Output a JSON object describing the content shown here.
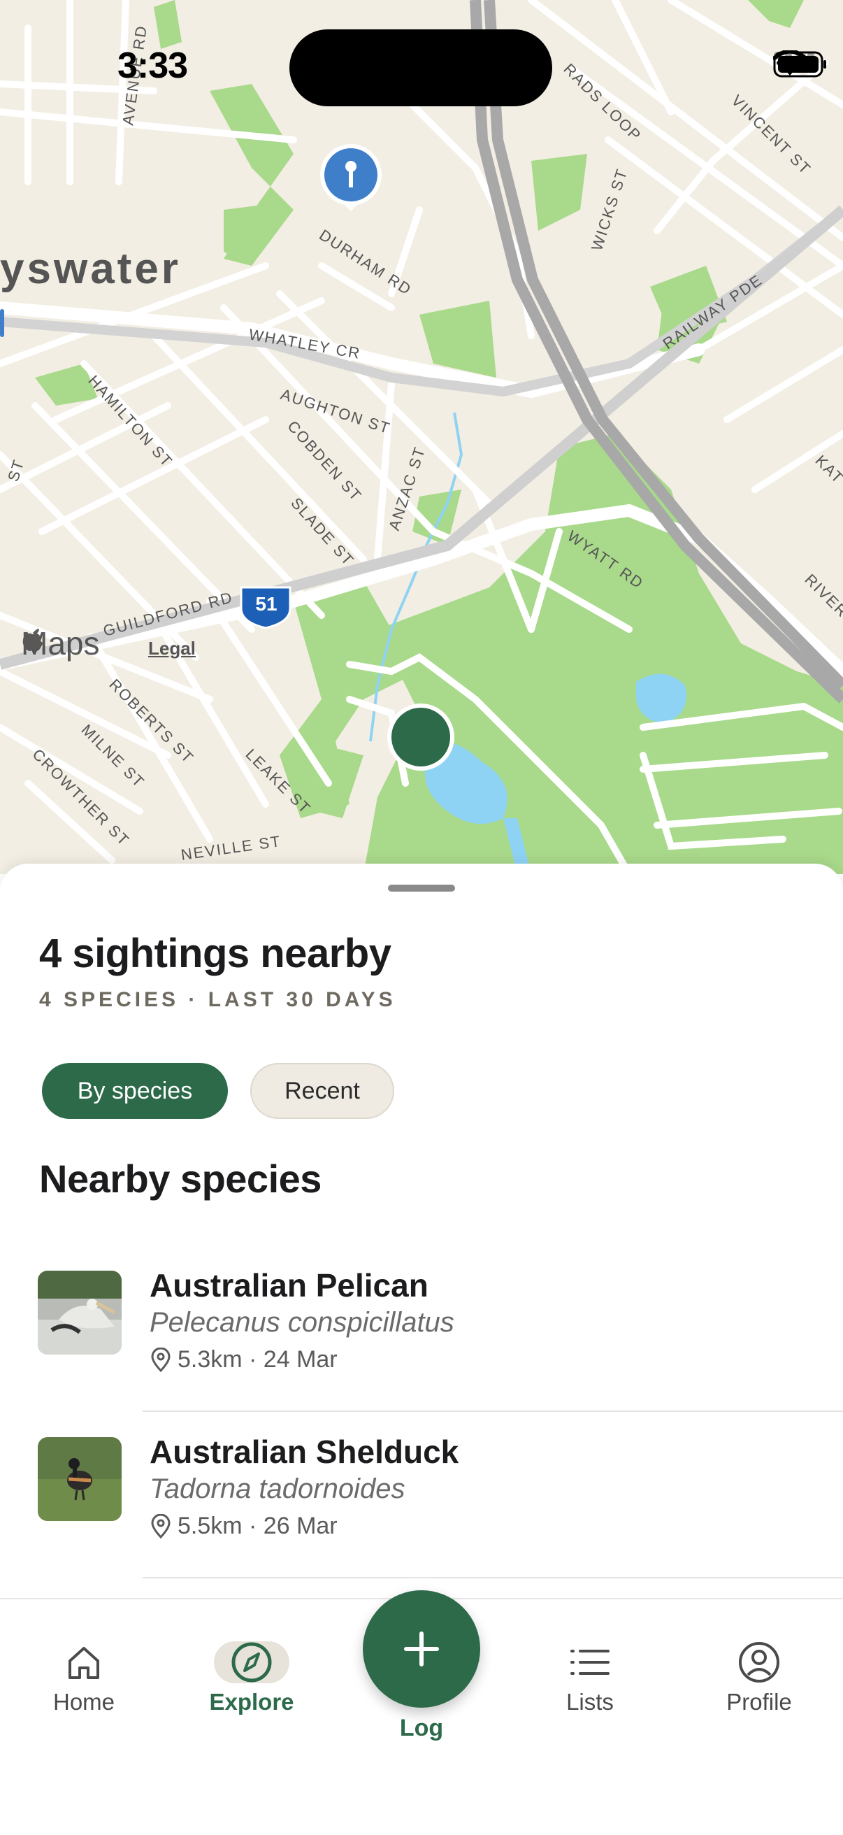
{
  "status_bar": {
    "time": "3:33"
  },
  "map": {
    "suburb_label": "yswater",
    "route_shield": "51",
    "attribution_brand": "Maps",
    "legal_link": "Legal",
    "street_labels": [
      "AVENUE RD",
      "DURHAM RD",
      "WHATLEY CR",
      "HAMILTON ST",
      "AUGHTON ST",
      "COBDEN ST",
      "SLADE ST",
      "ANZAC ST",
      "WYATT RD",
      "GUILDFORD RD",
      "ROBERTS ST",
      "MILNE ST",
      "CROWTHER ST",
      "LEAKE ST",
      "NEVILLE ST",
      "WICKS ST",
      "RAILWAY PDE",
      "VINCENT ST",
      "RIVER",
      "KAT",
      "ST",
      "LOOP"
    ],
    "colors": {
      "land": "#f3eee3",
      "park": "#a9d98a",
      "water": "#8fd3f4",
      "road": "#ffffff",
      "freeway": "#a8a8a8",
      "marker": "#2c6a4a",
      "pin": "#3f7fc9"
    }
  },
  "sheet": {
    "title": "4 sightings nearby",
    "subtitle": "4 SPECIES · LAST 30 DAYS",
    "filters": [
      {
        "label": "By species",
        "active": true
      },
      {
        "label": "Recent",
        "active": false
      }
    ],
    "section_title": "Nearby species",
    "species": [
      {
        "name": "Australian Pelican",
        "scientific": "Pelecanus conspicillatus",
        "meta": "5.3km · 24 Mar"
      },
      {
        "name": "Australian Shelduck",
        "scientific": "Tadorna tadornoides",
        "meta": "5.5km · 26 Mar"
      }
    ]
  },
  "tabbar": {
    "tabs": [
      {
        "label": "Home",
        "icon": "home-icon",
        "active": false
      },
      {
        "label": "Explore",
        "icon": "compass-icon",
        "active": true
      },
      {
        "label": "Lists",
        "icon": "list-icon",
        "active": false
      },
      {
        "label": "Profile",
        "icon": "profile-icon",
        "active": false
      }
    ],
    "fab_label": "Log",
    "accent": "#2c6a4a"
  }
}
